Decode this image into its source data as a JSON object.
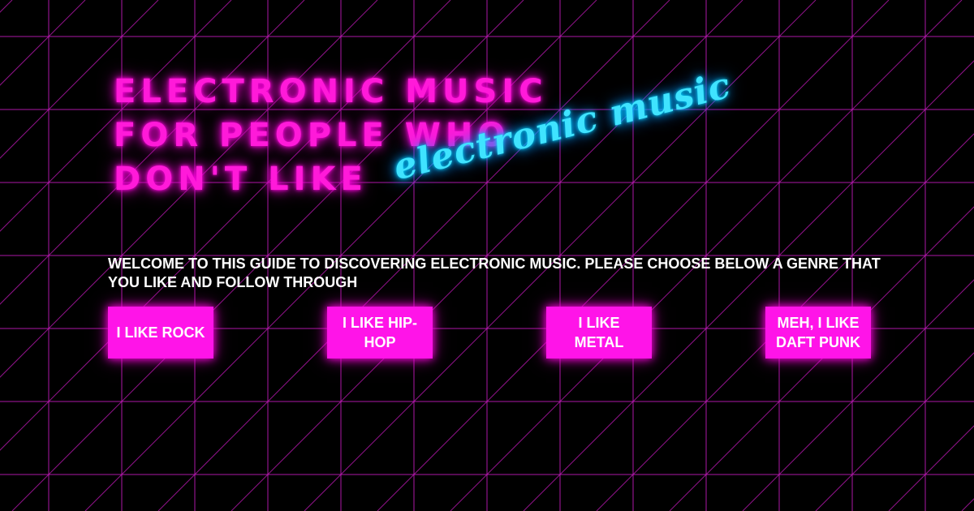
{
  "colors": {
    "background": "#000000",
    "grid": "#c01ab8",
    "title": "#ff1ad9",
    "script": "#3fe3ff",
    "button": "#ff14e8",
    "text": "#ffffff"
  },
  "hero": {
    "title_lines": [
      "ELECTRONIC MUSIC",
      "FOR PEOPLE WHO",
      "DON'T LIKE"
    ],
    "script_text": "electronic music"
  },
  "intro": {
    "text": "WELCOME TO THIS GUIDE TO DISCOVERING ELECTRONIC MUSIC. PLEASE CHOOSE BELOW A GENRE THAT YOU LIKE AND FOLLOW THROUGH"
  },
  "buttons": [
    {
      "label": "I LIKE ROCK"
    },
    {
      "label": "I LIKE HIP-HOP"
    },
    {
      "label": "I LIKE METAL"
    },
    {
      "label": "MEH, I LIKE DAFT PUNK"
    }
  ]
}
